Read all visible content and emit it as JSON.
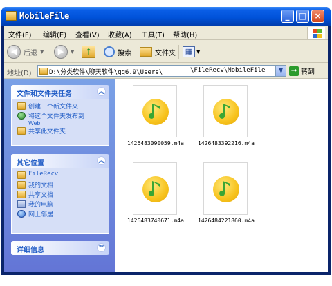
{
  "window": {
    "title": "MobileFile",
    "minimize_label": "_",
    "maximize_label": "□",
    "close_label": "×"
  },
  "menu": {
    "items": [
      {
        "label": "文件(F)"
      },
      {
        "label": "编辑(E)"
      },
      {
        "label": "查看(V)"
      },
      {
        "label": "收藏(A)"
      },
      {
        "label": "工具(T)"
      },
      {
        "label": "帮助(H)"
      }
    ]
  },
  "toolbar": {
    "back_label": "后退",
    "back_glyph": "◀",
    "forward_glyph": "▶",
    "up_glyph": "↑",
    "search_label": "搜索",
    "folders_label": "文件夹",
    "views_glyph": "▦"
  },
  "address": {
    "label": "地址(D)",
    "path_left": "D:\\分类软件\\聊天软件\\qq6.9\\Users\\",
    "path_right": "\\FileRecv\\MobileFile",
    "go_label": "转到",
    "go_glyph": "→",
    "dropdown_glyph": "▼"
  },
  "taskpane": {
    "tasks_panel": {
      "title": "文件和文件夹任务",
      "chevron": "︽",
      "items": [
        {
          "label": "创建一个新文件夹",
          "icon": "new-folder-icon"
        },
        {
          "label": "将这个文件夹发布到",
          "sub": "Web",
          "icon": "publish-web-icon"
        },
        {
          "label": "共享此文件夹",
          "icon": "share-folder-icon"
        }
      ]
    },
    "places_panel": {
      "title": "其它位置",
      "chevron": "︽",
      "items": [
        {
          "label": "FileRecv",
          "icon": "folder-icon"
        },
        {
          "label": "我的文档",
          "icon": "my-documents-icon"
        },
        {
          "label": "共享文档",
          "icon": "shared-documents-icon"
        },
        {
          "label": "我的电脑",
          "icon": "my-computer-icon"
        },
        {
          "label": "网上邻居",
          "icon": "network-places-icon"
        }
      ]
    },
    "details_panel": {
      "title": "详细信息",
      "chevron": "︾"
    }
  },
  "files": [
    {
      "name": "1426483090059.m4a"
    },
    {
      "name": "1426483392216.m4a"
    },
    {
      "name": "1426483740671.m4a"
    },
    {
      "name": "1426484221860.m4a"
    }
  ],
  "colors": {
    "titlebar": "#0052d9",
    "taskpane_bg": "#6f8ae0",
    "panel_title": "#215dc6",
    "note_yellow": "#f7c21c",
    "note_green": "#3aa635"
  }
}
